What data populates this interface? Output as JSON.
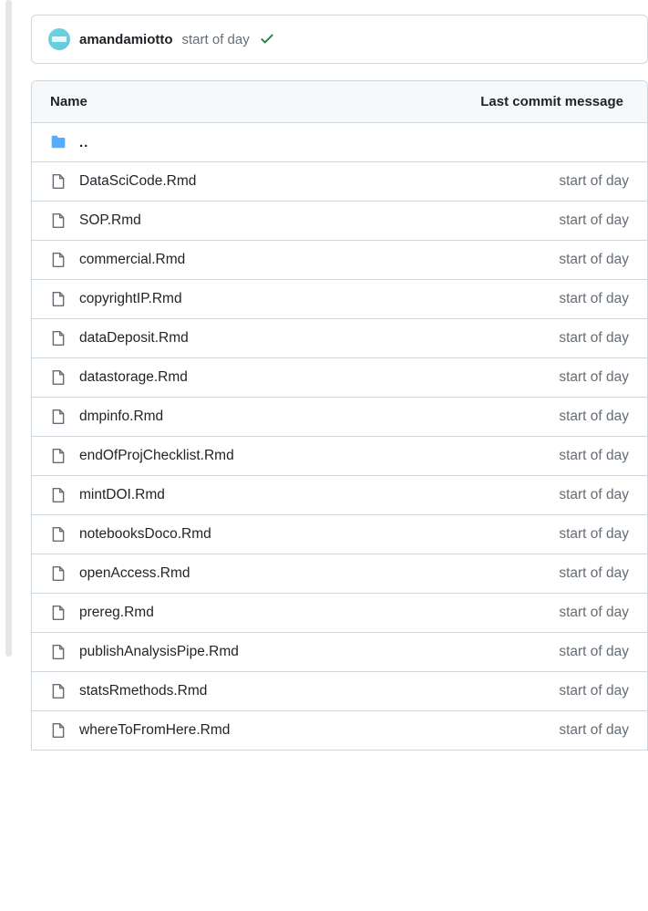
{
  "commit": {
    "author": "amandamiotto",
    "message": "start of day"
  },
  "header": {
    "name": "Name",
    "commit_msg": "Last commit message"
  },
  "parent_dir_label": "..",
  "files": [
    {
      "name": "DataSciCode.Rmd",
      "msg": "start of day"
    },
    {
      "name": "SOP.Rmd",
      "msg": "start of day"
    },
    {
      "name": "commercial.Rmd",
      "msg": "start of day"
    },
    {
      "name": "copyrightIP.Rmd",
      "msg": "start of day"
    },
    {
      "name": "dataDeposit.Rmd",
      "msg": "start of day"
    },
    {
      "name": "datastorage.Rmd",
      "msg": "start of day"
    },
    {
      "name": "dmpinfo.Rmd",
      "msg": "start of day"
    },
    {
      "name": "endOfProjChecklist.Rmd",
      "msg": "start of day"
    },
    {
      "name": "mintDOI.Rmd",
      "msg": "start of day"
    },
    {
      "name": "notebooksDoco.Rmd",
      "msg": "start of day"
    },
    {
      "name": "openAccess.Rmd",
      "msg": "start of day"
    },
    {
      "name": "prereg.Rmd",
      "msg": "start of day"
    },
    {
      "name": "publishAnalysisPipe.Rmd",
      "msg": "start of day"
    },
    {
      "name": "statsRmethods.Rmd",
      "msg": "start of day"
    },
    {
      "name": "whereToFromHere.Rmd",
      "msg": "start of day"
    }
  ]
}
